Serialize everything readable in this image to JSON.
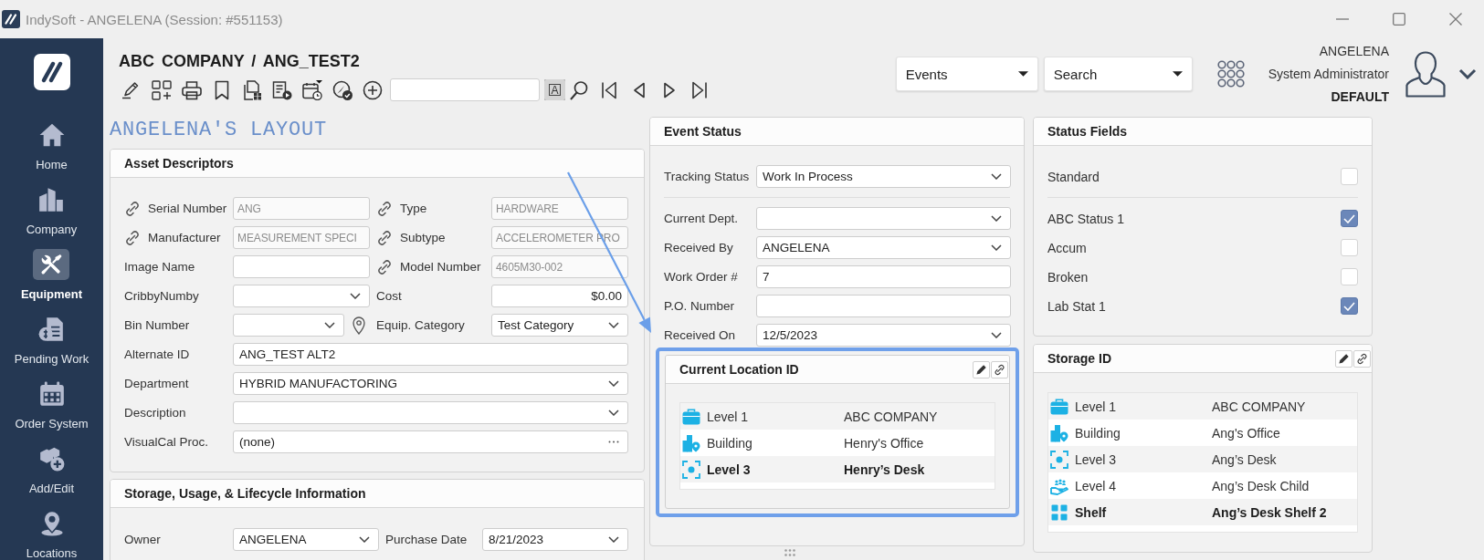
{
  "window": {
    "title": "IndySoft - ANGELENA (Session: #551153)"
  },
  "sidebar": {
    "items": [
      {
        "label": "Home",
        "selected": false
      },
      {
        "label": "Company",
        "selected": false
      },
      {
        "label": "Equipment",
        "selected": true
      },
      {
        "label": "Pending Work",
        "selected": false
      },
      {
        "label": "Order System",
        "selected": false
      },
      {
        "label": "Add/Edit",
        "selected": false
      },
      {
        "label": "Locations",
        "selected": false
      }
    ]
  },
  "header": {
    "title": "ABC COMPANY / ANG_TEST2",
    "toggle": {
      "label": "A",
      "on": true
    },
    "dropdowns": [
      {
        "value": "Events"
      },
      {
        "value": "Search"
      }
    ],
    "user": {
      "name": "ANGELENA",
      "role": "System Administrator",
      "profile": "DEFAULT"
    }
  },
  "layout_title": "ANGELENA'S LAYOUT",
  "asset_descriptors": {
    "title": "Asset Descriptors",
    "rows": [
      {
        "fields": [
          {
            "label": "Serial Number",
            "value": "ANG",
            "kind": "text",
            "linked": true
          },
          {
            "label": "Type",
            "value": "HARDWARE",
            "kind": "text",
            "linked": true
          }
        ]
      },
      {
        "fields": [
          {
            "label": "Manufacturer",
            "value": "MEASUREMENT SPECI",
            "kind": "text",
            "linked": true
          },
          {
            "label": "Subtype",
            "value": "ACCELEROMETER PRO",
            "kind": "text",
            "linked": true
          }
        ]
      },
      {
        "fields": [
          {
            "label": "Image Name",
            "kind": "text",
            "linked": false
          },
          {
            "label": "Model Number",
            "value": "4605M30-002",
            "kind": "text",
            "linked": true
          }
        ]
      },
      {
        "fields": [
          {
            "label": "CribbyNumby",
            "kind": "select",
            "linked": false
          },
          {
            "label": "Cost",
            "value": "$0.00",
            "kind": "currency",
            "linked": false
          }
        ]
      },
      {
        "fields": [
          {
            "label": "Bin Number",
            "kind": "location_select",
            "linked": false
          },
          {
            "label": "Equip. Category",
            "value": "Test Category",
            "kind": "select",
            "linked": false
          }
        ]
      },
      {
        "fields": [
          {
            "label": "Alternate ID",
            "value": "ANG_TEST ALT2",
            "kind": "text",
            "linked": false
          }
        ]
      },
      {
        "fields": [
          {
            "label": "Department",
            "value": "HYBRID MANUFACTORING",
            "kind": "select",
            "linked": false
          }
        ]
      },
      {
        "fields": [
          {
            "label": "Description",
            "kind": "select",
            "linked": false
          }
        ]
      },
      {
        "fields": [
          {
            "label": "VisualCal Proc.",
            "value": "(none)",
            "kind": "browse",
            "linked": false
          }
        ]
      }
    ]
  },
  "storage_usage": {
    "title": "Storage, Usage, & Lifecycle Information",
    "rows": [
      {
        "fields": [
          {
            "label": "Owner",
            "value": "ANGELENA",
            "kind": "select",
            "linked": false
          },
          {
            "label": "Purchase Date",
            "value": "8/21/2023",
            "kind": "select",
            "linked": false
          }
        ]
      }
    ]
  },
  "event_status": {
    "title": "Event Status",
    "groups": [
      {
        "fields": [
          {
            "label": "Tracking Status",
            "value": "Work In Process",
            "kind": "select"
          }
        ]
      },
      {
        "fields": [
          {
            "label": "Current Dept.",
            "kind": "select"
          },
          {
            "label": "Received By",
            "value": "ANGELENA",
            "kind": "select"
          },
          {
            "label": "Work Order #",
            "value": "7",
            "kind": "text"
          },
          {
            "label": "P.O. Number",
            "kind": "text"
          },
          {
            "label": "Received On",
            "value": "12/5/2023",
            "kind": "select"
          }
        ]
      }
    ]
  },
  "current_location": {
    "title": "Current Location ID",
    "highlighted": true,
    "rows": [
      {
        "level": "Level 1",
        "name": "ABC COMPANY",
        "selected": false
      },
      {
        "level": "Building",
        "name": "Henry's Office",
        "selected": false
      },
      {
        "level": "Level 3",
        "name": "Henry’s Desk",
        "selected": true
      }
    ]
  },
  "status_fields": {
    "title": "Status Fields",
    "groups": [
      {
        "items": [
          {
            "label": "Standard",
            "checked": false
          }
        ]
      },
      {
        "items": [
          {
            "label": "ABC Status 1",
            "checked": true
          },
          {
            "label": "Accum",
            "checked": false
          },
          {
            "label": "Broken",
            "checked": false
          },
          {
            "label": "Lab Stat 1",
            "checked": true
          }
        ]
      }
    ]
  },
  "storage_id": {
    "title": "Storage ID",
    "rows": [
      {
        "level": "Level 1",
        "name": "ABC COMPANY",
        "selected": false
      },
      {
        "level": "Building",
        "name": "Ang's Office",
        "selected": false
      },
      {
        "level": "Level 3",
        "name": "Ang’s Desk",
        "selected": false
      },
      {
        "level": "Level 4",
        "name": "Ang’s Desk Child",
        "selected": false
      },
      {
        "level": "Shelf",
        "name": "Ang’s Desk Shelf 2",
        "selected": true
      }
    ]
  }
}
